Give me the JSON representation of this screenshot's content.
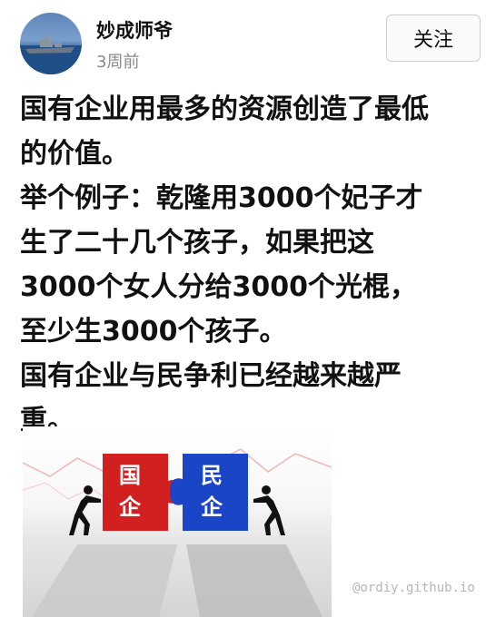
{
  "user": {
    "name": "妙成师爷",
    "time": "3周前"
  },
  "follow_button": "关注",
  "post": {
    "lines": [
      "国有企业用最多的资源创造了最低",
      "的价值。",
      "举个例子：乾隆用3000个妃子才",
      "生了二十几个孩子，如果把这",
      "3000个女人分给3000个光棍，",
      "至少生3000个孩子。",
      "国有企业与民争利已经越来越严",
      "重。"
    ]
  },
  "image": {
    "left_piece": "国\n企",
    "left_top": "国",
    "left_bottom": "企",
    "right_top": "民",
    "right_bottom": "企"
  },
  "watermark": "@ordiy.github.io",
  "colors": {
    "red_piece": "#d21f1f",
    "blue_piece": "#1a45c6",
    "muted_text": "#8a8a8a"
  }
}
